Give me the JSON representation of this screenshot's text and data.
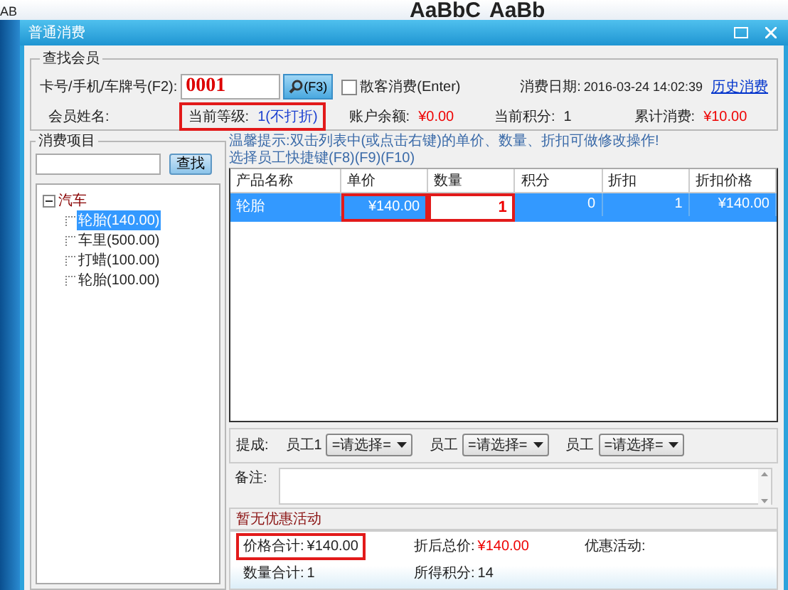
{
  "backdrop": {
    "texts": [
      "AB",
      "AaBbC",
      "AaBb"
    ]
  },
  "window": {
    "title": "普通消费"
  },
  "member": {
    "legend": "查找会员",
    "card_label": "卡号/手机/车牌号(F2):",
    "card_value": "0001",
    "search_button": "(F3)",
    "walk_in": {
      "label": "散客消费(Enter)",
      "checked": false
    },
    "date_label": "消费日期:",
    "date_value": "2016-03-24 14:02:39",
    "history_link": "历史消费",
    "fields": [
      {
        "label": "会员姓名:",
        "kind": "plain",
        "highlighted": false
      },
      {
        "label": "当前等级:",
        "value": "1(不打折)",
        "kind": "level",
        "highlighted": true
      },
      {
        "label": "账户余额:",
        "value": "¥0.00",
        "kind": "money",
        "highlighted": false
      },
      {
        "label": "当前积分:",
        "value": "1",
        "kind": "plain",
        "highlighted": false
      },
      {
        "label": "累计消费:",
        "value": "¥10.00",
        "kind": "money",
        "highlighted": false
      }
    ]
  },
  "items": {
    "legend": "消费项目",
    "search_button": "查找",
    "tree": [
      {
        "label": "汽车",
        "expanded": true,
        "selected": false,
        "children": [
          {
            "label": "轮胎(140.00)",
            "selected": true
          },
          {
            "label": "车里(500.00)",
            "selected": false
          },
          {
            "label": "打蜡(100.00)",
            "selected": false
          },
          {
            "label": "轮胎(100.00)",
            "selected": false
          }
        ]
      }
    ]
  },
  "hint": "温馨提示:双击列表中(或点击右键)的单价、数量、折扣可做修改操作!",
  "hotkey_hint": "选择员工快捷键(F8)(F9)(F10)",
  "table": {
    "columns": [
      "产品名称",
      "单价",
      "数量",
      "积分",
      "折扣",
      "折扣价格"
    ],
    "rows": [
      {
        "selected": true,
        "cells": [
          "轮胎",
          "¥140.00",
          "1",
          "0",
          "1",
          "¥140.00"
        ]
      }
    ]
  },
  "commission": {
    "label": "提成:",
    "staff": [
      {
        "label": "员工1",
        "value": "=请选择="
      },
      {
        "label": "员工",
        "value": "=请选择="
      },
      {
        "label": "员工",
        "value": "=请选择="
      }
    ]
  },
  "remarks": {
    "label": "备注:"
  },
  "promotion": "暂无优惠活动",
  "totals": [
    {
      "label": "价格合计:",
      "value": "¥140.00",
      "kind": "plain",
      "highlighted": true
    },
    {
      "label": "折后总价:",
      "value": "¥140.00",
      "kind": "money",
      "highlighted": false
    },
    {
      "label": "优惠活动:",
      "kind": "plain",
      "highlighted": false
    },
    {
      "label": "数量合计:",
      "value": "1",
      "kind": "plain",
      "highlighted": false
    },
    {
      "label": "所得积分:",
      "value": "14",
      "kind": "plain",
      "highlighted": false
    }
  ]
}
